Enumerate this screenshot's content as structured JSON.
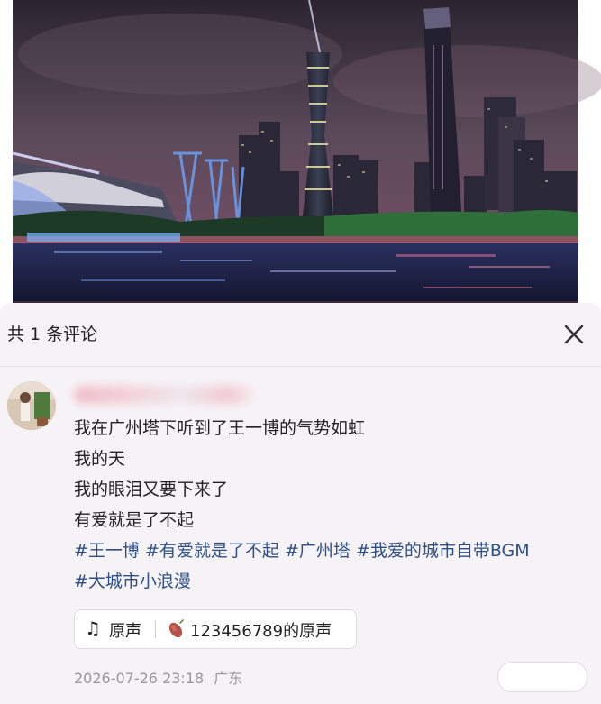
{
  "comments_panel": {
    "title": "共 1 条评论",
    "close_icon": "close-icon"
  },
  "comment": {
    "text_lines": [
      "我在广州塔下听到了王一博的气势如虹",
      "我的天",
      "我的眼泪又要下来了",
      "有爱就是了不起"
    ],
    "hashtags_line1": [
      "#王一博",
      "#有爱就是了不起",
      "#广州塔",
      "#我爱的城市自带BGM"
    ],
    "hashtags_line2": [
      "#大城市小浪漫"
    ],
    "audio": {
      "note_icon": "music-note-icon",
      "original_label": "原声",
      "sweet_potato_icon": "sweet-potato-icon",
      "source_label": "123456789的原声"
    },
    "timestamp": "2026-07-26 23:18",
    "location": "广东"
  },
  "colors": {
    "hashtag": "#2e4f86",
    "panel_bg": "#f6f3f6",
    "meta_text": "#9a979a"
  }
}
